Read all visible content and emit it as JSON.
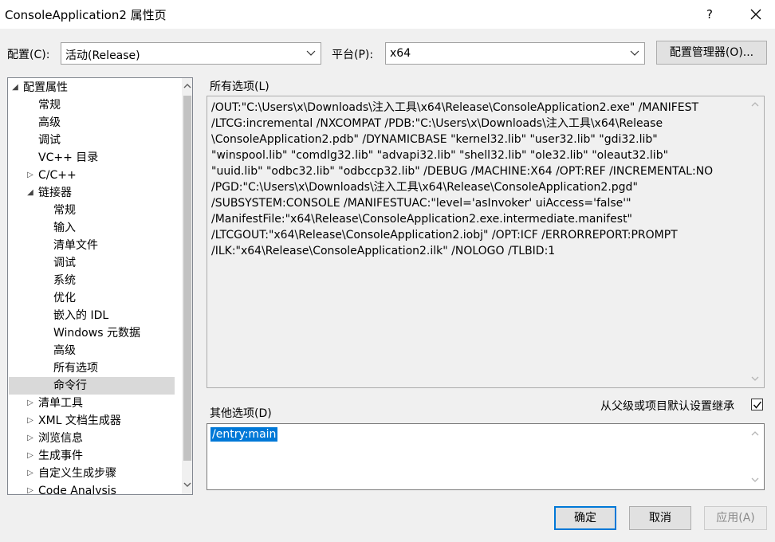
{
  "window": {
    "title": "ConsoleApplication2 属性页",
    "help_label": "?"
  },
  "config_row": {
    "config_label": "配置(C):",
    "config_value": "活动(Release)",
    "platform_label": "平台(P):",
    "platform_value": "x64",
    "manager_button": "配置管理器(O)..."
  },
  "tree": {
    "items": [
      {
        "label": "配置属性",
        "expander": "◢",
        "level": 0
      },
      {
        "label": "常规",
        "expander": "",
        "level": 1
      },
      {
        "label": "高级",
        "expander": "",
        "level": 1
      },
      {
        "label": "调试",
        "expander": "",
        "level": 1
      },
      {
        "label": "VC++ 目录",
        "expander": "",
        "level": 1
      },
      {
        "label": "C/C++",
        "expander": "▷",
        "level": 1
      },
      {
        "label": "链接器",
        "expander": "◢",
        "level": 1
      },
      {
        "label": "常规",
        "expander": "",
        "level": 2
      },
      {
        "label": "输入",
        "expander": "",
        "level": 2
      },
      {
        "label": "清单文件",
        "expander": "",
        "level": 2
      },
      {
        "label": "调试",
        "expander": "",
        "level": 2
      },
      {
        "label": "系统",
        "expander": "",
        "level": 2
      },
      {
        "label": "优化",
        "expander": "",
        "level": 2
      },
      {
        "label": "嵌入的 IDL",
        "expander": "",
        "level": 2
      },
      {
        "label": "Windows 元数据",
        "expander": "",
        "level": 2
      },
      {
        "label": "高级",
        "expander": "",
        "level": 2
      },
      {
        "label": "所有选项",
        "expander": "",
        "level": 2
      },
      {
        "label": "命令行",
        "expander": "",
        "level": 2,
        "selected": true
      },
      {
        "label": "清单工具",
        "expander": "▷",
        "level": 1
      },
      {
        "label": "XML 文档生成器",
        "expander": "▷",
        "level": 1
      },
      {
        "label": "浏览信息",
        "expander": "▷",
        "level": 1
      },
      {
        "label": "生成事件",
        "expander": "▷",
        "level": 1
      },
      {
        "label": "自定义生成步骤",
        "expander": "▷",
        "level": 1
      },
      {
        "label": "Code Analysis",
        "expander": "▷",
        "level": 1
      }
    ]
  },
  "all_options": {
    "label": "所有选项(L)",
    "lines": [
      "/OUT:\"C:\\Users\\x\\Downloads\\注入工具\\x64\\Release\\ConsoleApplication2.exe\" /MANIFEST",
      "/LTCG:incremental /NXCOMPAT /PDB:\"C:\\Users\\x\\Downloads\\注入工具\\x64\\Release",
      "\\ConsoleApplication2.pdb\" /DYNAMICBASE \"kernel32.lib\" \"user32.lib\" \"gdi32.lib\"",
      "\"winspool.lib\" \"comdlg32.lib\" \"advapi32.lib\" \"shell32.lib\" \"ole32.lib\" \"oleaut32.lib\"",
      "\"uuid.lib\" \"odbc32.lib\" \"odbccp32.lib\" /DEBUG /MACHINE:X64 /OPT:REF /INCREMENTAL:NO",
      "/PGD:\"C:\\Users\\x\\Downloads\\注入工具\\x64\\Release\\ConsoleApplication2.pgd\"",
      "/SUBSYSTEM:CONSOLE /MANIFESTUAC:\"level='asInvoker' uiAccess='false'\"",
      "/ManifestFile:\"x64\\Release\\ConsoleApplication2.exe.intermediate.manifest\"",
      "/LTCGOUT:\"x64\\Release\\ConsoleApplication2.iobj\" /OPT:ICF /ERRORREPORT:PROMPT",
      "/ILK:\"x64\\Release\\ConsoleApplication2.ilk\" /NOLOGO /TLBID:1"
    ]
  },
  "other_options": {
    "label": "其他选项(D)",
    "value": "/entry:main",
    "inherit_label": "从父级或项目默认设置继承",
    "inherit_checked": true
  },
  "buttons": {
    "ok": "确定",
    "cancel": "取消",
    "apply": "应用(A)"
  }
}
